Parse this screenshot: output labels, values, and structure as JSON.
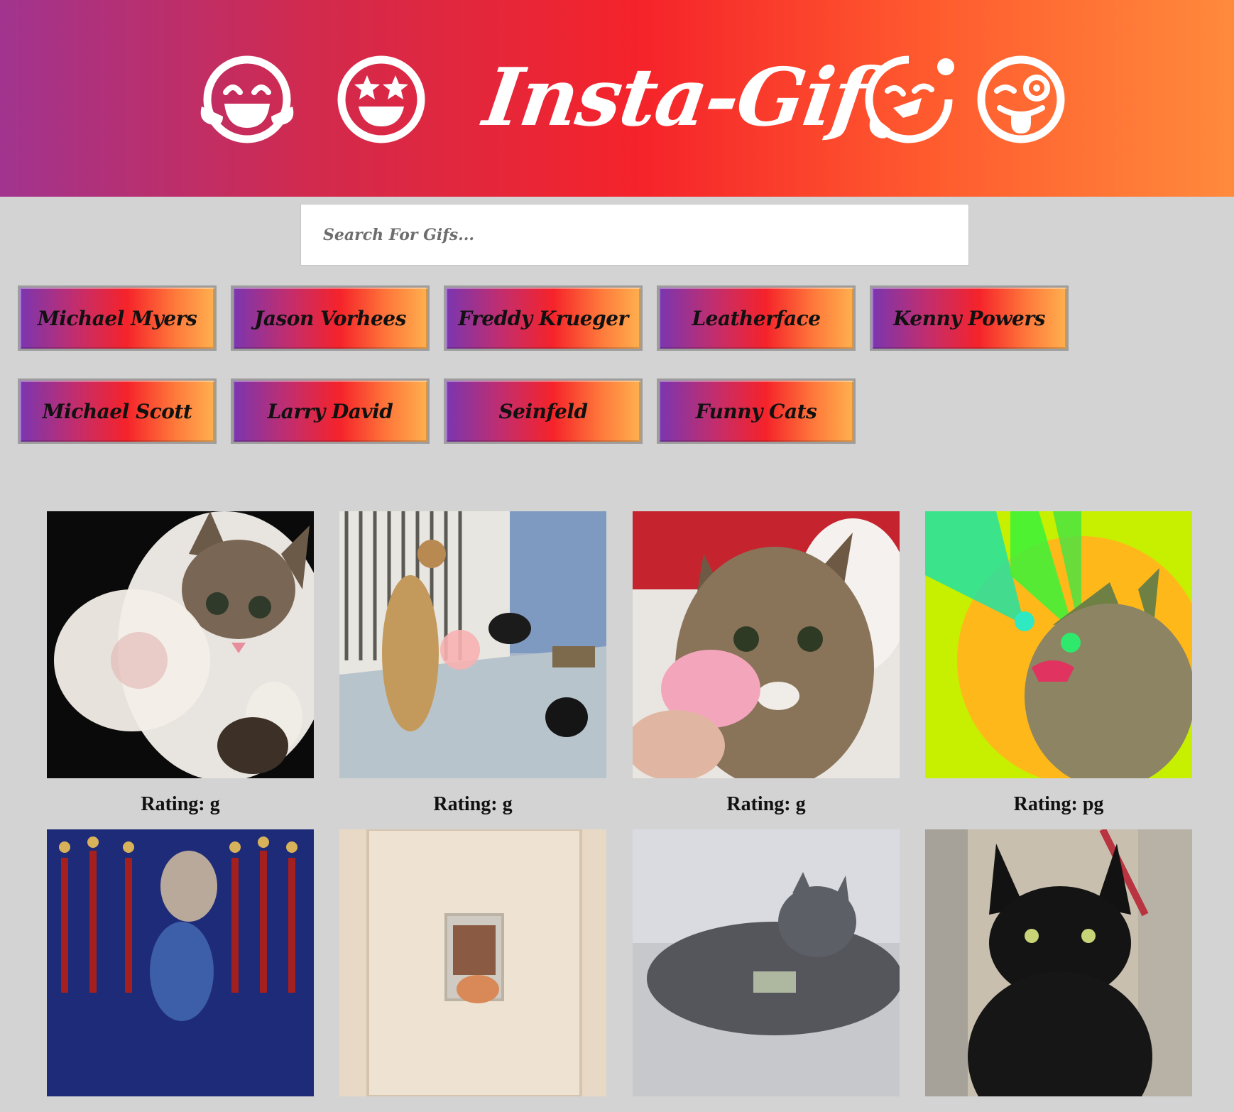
{
  "header": {
    "title": "Insta-Gif",
    "icons": [
      "laughing-face-icon",
      "star-eyes-face-icon",
      "zany-face-icon",
      "winking-tongue-face-icon"
    ]
  },
  "search": {
    "placeholder": "Search For Gifs..."
  },
  "topics": [
    "Michael Myers",
    "Jason Vorhees",
    "Freddy Krueger",
    "Leatherface",
    "Kenny Powers",
    "Michael Scott",
    "Larry David",
    "Seinfeld",
    "Funny Cats"
  ],
  "gifs": [
    {
      "rating": "Rating: g"
    },
    {
      "rating": "Rating: g"
    },
    {
      "rating": "Rating: g"
    },
    {
      "rating": "Rating: pg"
    },
    {
      "rating": ""
    },
    {
      "rating": ""
    },
    {
      "rating": ""
    },
    {
      "rating": ""
    }
  ],
  "colors": {
    "background": "#d3d3d3",
    "header_gradient": [
      "#a1348f",
      "#f5232a",
      "#ff8a3c"
    ],
    "button_gradient": [
      "#7a36b0",
      "#f5232a",
      "#ffb04f"
    ]
  }
}
